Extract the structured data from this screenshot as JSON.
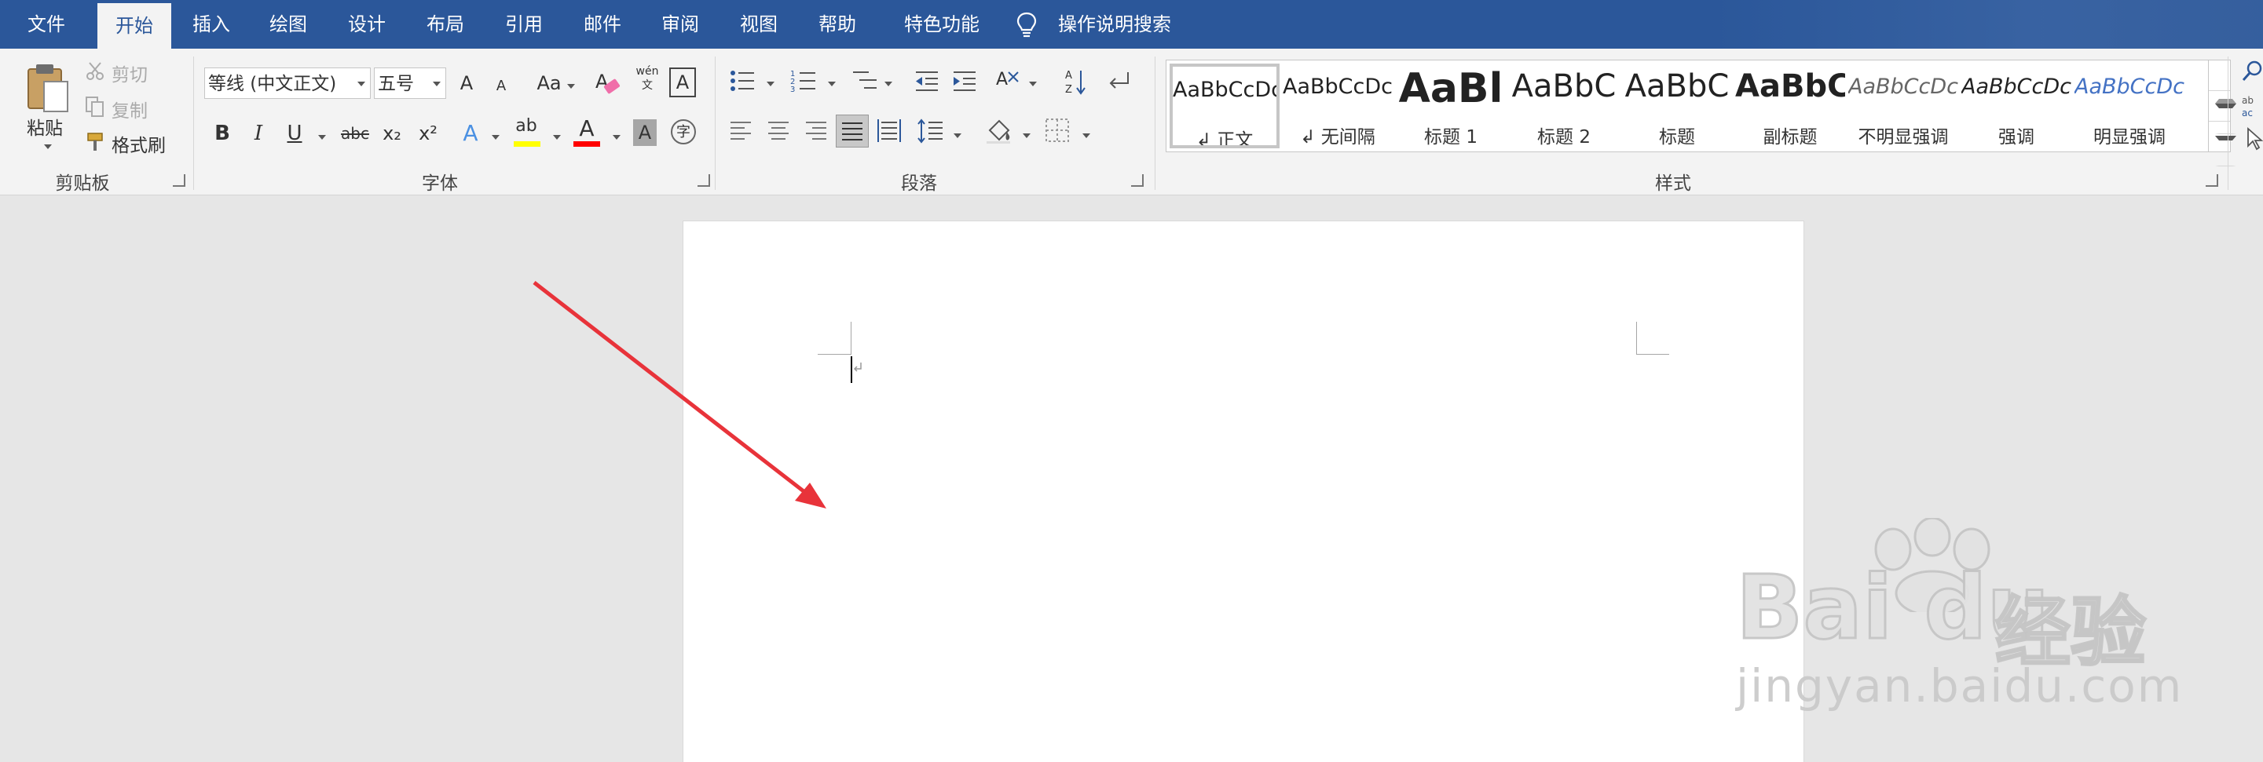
{
  "menu": {
    "tabs": [
      "文件",
      "开始",
      "插入",
      "绘图",
      "设计",
      "布局",
      "引用",
      "邮件",
      "审阅",
      "视图",
      "帮助",
      "特色功能"
    ],
    "active_tab": "开始",
    "tell_me": "操作说明搜索"
  },
  "clipboard": {
    "paste": "粘贴",
    "cut": "剪切",
    "copy": "复制",
    "format_painter": "格式刷",
    "group": "剪贴板"
  },
  "font": {
    "name": "等线 (中文正文)",
    "size": "五号",
    "grow": "A",
    "shrink": "A",
    "change_case": "Aa",
    "phonetic": "wén 文",
    "border_char": "A",
    "bold": "B",
    "italic": "I",
    "underline": "U",
    "strike": "abc",
    "subscript": "x₂",
    "superscript": "x²",
    "text_effect": "A",
    "highlight": "ab",
    "font_color": "A",
    "char_shading": "A",
    "enclose": "字",
    "group": "字体"
  },
  "paragraph": {
    "group": "段落"
  },
  "styles": {
    "group": "样式",
    "items": [
      {
        "preview": "AaBbCcDc",
        "name": "↲ 正文"
      },
      {
        "preview": "AaBbCcDc",
        "name": "↲ 无间隔"
      },
      {
        "preview": "AaBl",
        "name": "标题 1"
      },
      {
        "preview": "AaBbC",
        "name": "标题 2"
      },
      {
        "preview": "AaBbC",
        "name": "标题"
      },
      {
        "preview": "AaBbC",
        "name": "副标题"
      },
      {
        "preview": "AaBbCcDc",
        "name": "不明显强调"
      },
      {
        "preview": "AaBbCcDc",
        "name": "强调"
      },
      {
        "preview": "AaBbCcDc",
        "name": "明显强调"
      }
    ]
  },
  "watermark": {
    "brand": "Bai",
    "brand2": "du",
    "cn": "经验",
    "url": "jingyan.baidu.com"
  },
  "colors": {
    "titlebar": "#2b579a",
    "highlight": "#ffff00",
    "font_color": "#ff0000",
    "arrow": "#e8333a"
  }
}
